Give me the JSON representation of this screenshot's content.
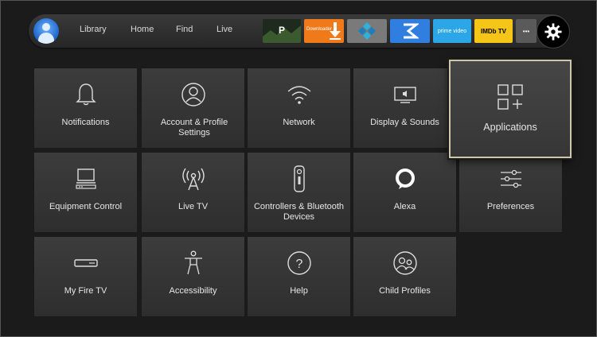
{
  "nav": {
    "links": [
      "Library",
      "Home",
      "Find",
      "Live"
    ],
    "apps": [
      {
        "name": "p-app-icon",
        "text": "P",
        "bg": "#2a2a2a"
      },
      {
        "name": "downloader-app-icon",
        "text": "Downloader",
        "bg": "#f07a1a"
      },
      {
        "name": "kodi-app-icon",
        "text": "",
        "bg": "#7d7d7d"
      },
      {
        "name": "app-s-icon",
        "text": "",
        "bg": "#2f7ee0"
      },
      {
        "name": "prime-video-app-icon",
        "text": "prime video",
        "bg": "#2ba6e6"
      },
      {
        "name": "imdb-tv-app-icon",
        "text": "IMDb TV",
        "bg": "#f5c518"
      },
      {
        "name": "more-apps-icon",
        "text": "•••",
        "bg": "#5a5a5a"
      }
    ]
  },
  "settings": {
    "tiles": [
      {
        "label": "Notifications",
        "icon": "bell-icon"
      },
      {
        "label": "Account & Profile Settings",
        "icon": "person-icon"
      },
      {
        "label": "Network",
        "icon": "wifi-icon"
      },
      {
        "label": "Display & Sounds",
        "icon": "display-icon"
      },
      {
        "label": "Applications",
        "icon": "apps-grid-icon"
      },
      {
        "label": "Equipment Control",
        "icon": "equipment-icon"
      },
      {
        "label": "Live TV",
        "icon": "antenna-icon"
      },
      {
        "label": "Controllers & Bluetooth Devices",
        "icon": "remote-icon"
      },
      {
        "label": "Alexa",
        "icon": "alexa-icon"
      },
      {
        "label": "Preferences",
        "icon": "sliders-icon"
      },
      {
        "label": "My Fire TV",
        "icon": "fire-tv-stick-icon"
      },
      {
        "label": "Accessibility",
        "icon": "accessibility-icon"
      },
      {
        "label": "Help",
        "icon": "help-icon"
      },
      {
        "label": "Child Profiles",
        "icon": "child-profiles-icon"
      }
    ],
    "focused": "Applications"
  },
  "colors": {
    "focus_border": "#cfc7a8",
    "tile_bg": "#3a3a3a",
    "alexa": "#ffffff"
  }
}
